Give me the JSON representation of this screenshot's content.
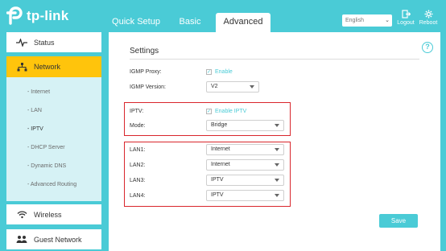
{
  "header": {
    "logo_text": "tp-link",
    "tabs": [
      {
        "label": "Quick Setup"
      },
      {
        "label": "Basic"
      },
      {
        "label": "Advanced"
      }
    ],
    "language": "English",
    "logout_label": "Logout",
    "reboot_label": "Reboot"
  },
  "sidebar": {
    "status": "Status",
    "network": "Network",
    "sub_items": [
      "- Internet",
      "- LAN",
      "- IPTV",
      "- DHCP Server",
      "- Dynamic DNS",
      "- Advanced Routing"
    ],
    "wireless": "Wireless",
    "guest": "Guest Network"
  },
  "main": {
    "section_title": "Settings",
    "igmp_proxy_label": "IGMP Proxy:",
    "igmp_proxy_check": "Enable",
    "igmp_version_label": "IGMP Version:",
    "igmp_version_value": "V2",
    "iptv_label": "IPTV:",
    "iptv_check": "Enable IPTV",
    "mode_label": "Mode:",
    "mode_value": "Bridge",
    "lan1_label": "LAN1:",
    "lan1_value": "Internet",
    "lan2_label": "LAN2:",
    "lan2_value": "Internet",
    "lan3_label": "LAN3:",
    "lan3_value": "IPTV",
    "lan4_label": "LAN4:",
    "lan4_value": "IPTV",
    "save_label": "Save"
  },
  "colors": {
    "brand": "#4acbd6",
    "active_nav": "#ffc40c",
    "highlight": "#d9262c"
  },
  "icons": {
    "help": "?"
  }
}
